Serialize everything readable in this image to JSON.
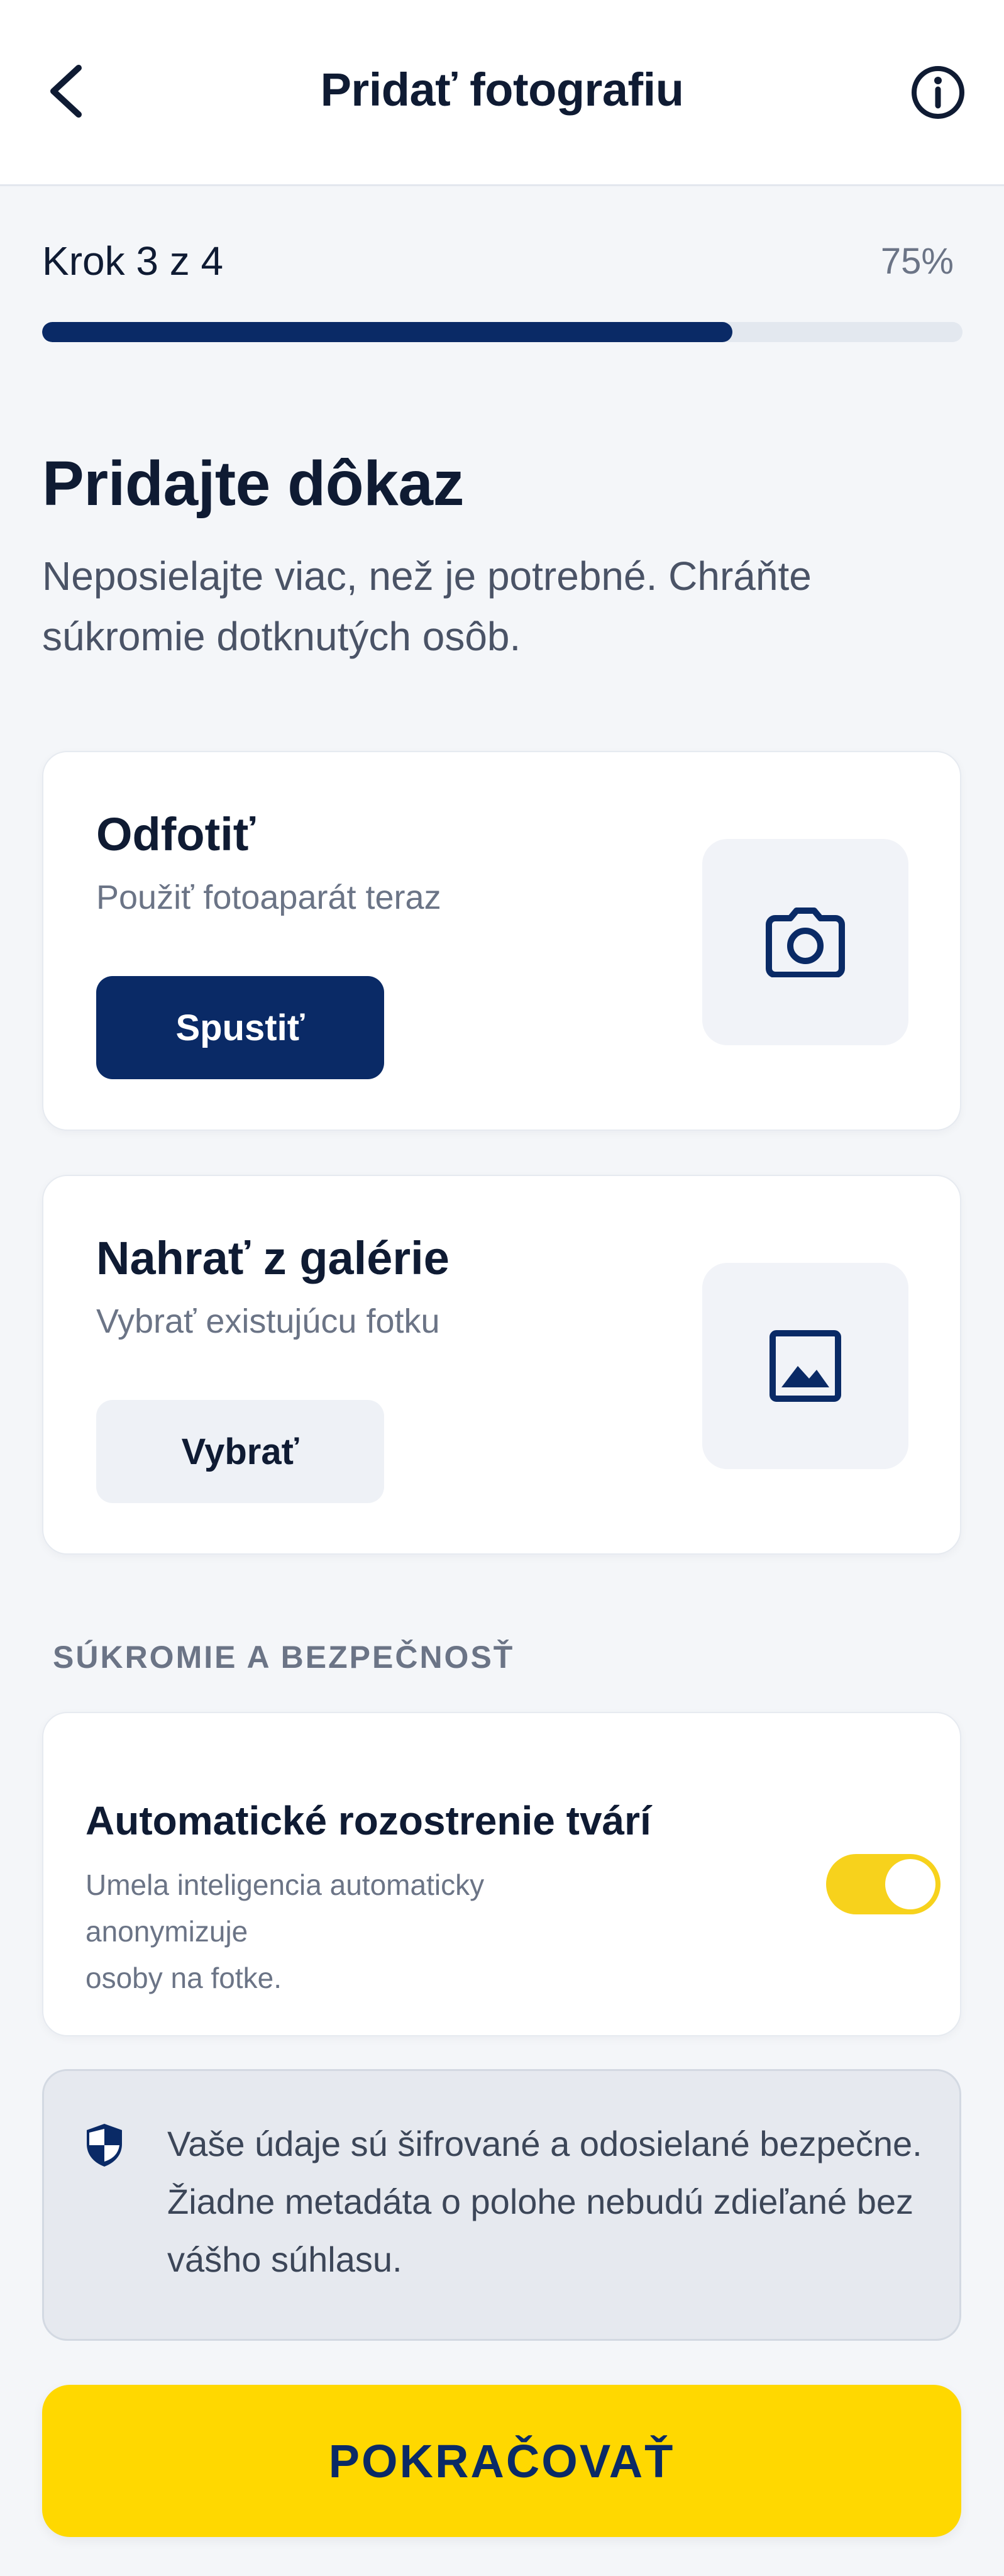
{
  "header": {
    "title": "Pridať fotografiu",
    "back_icon": "chevron-left-icon",
    "info_icon": "info-circle-icon"
  },
  "progress": {
    "step_label": "Krok 3 z 4",
    "percent_label": "75%",
    "value": 0.75
  },
  "main": {
    "title": "Pridajte dôkaz",
    "description": "Neposielajte viac, než je potrebné. Chráňte súkromie dotknutých osôb."
  },
  "camera_card": {
    "title": "Odfotiť",
    "subtitle": "Použiť fotoaparát teraz",
    "button_label": "Spustiť",
    "icon": "camera-icon"
  },
  "gallery_card": {
    "title": "Nahrať z galérie",
    "subtitle": "Vybrať existujúcu fotku",
    "button_label": "Vybrať",
    "icon": "image-icon"
  },
  "privacy": {
    "section_label": "SÚKROMIE A BEZPEČNOSŤ",
    "toggle_title": "Automatické rozostrenie tvárí",
    "toggle_desc_line1": "Umela inteligencia automaticky",
    "toggle_desc_line2": "anonymizuje",
    "toggle_desc_line3": "osoby na fotke.",
    "toggle_on": true
  },
  "notice": {
    "icon": "shield-icon",
    "text": "Vaše údaje sú šifrované a odosielané bezpečne. Žiadne metadáta o polohe nebudú zdieľané bez vášho súhlasu."
  },
  "cta": {
    "label": "POKRAČOVAŤ"
  },
  "colors": {
    "primary": "#0a2a66",
    "accent": "#ffd800",
    "background": "#f4f6f9",
    "muted_text": "#6b7486"
  }
}
